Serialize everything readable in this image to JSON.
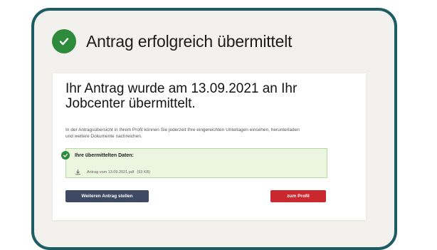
{
  "header": {
    "title": "Antrag erfolgreich übermittelt"
  },
  "card": {
    "heading": "Ihr Antrag wurde am 13.09.2021 an Ihr Jobcenter übermittelt.",
    "text": "In der Antragsübersicht in Ihrem Profil können Sie jederzeit Ihre eingereichten Unterlagen einsehen, herunterladen und weitere Dokumente nachreichen.",
    "data_box": {
      "title": "Ihre übermittelten Daten:",
      "file_name": "Antrag vom 13.09.2021.pdf",
      "file_size": "(93 KB)"
    },
    "buttons": {
      "secondary": "Weiteren Antrag stellen",
      "primary": "zum Profil"
    }
  },
  "colors": {
    "frame": "#1d5c62",
    "success": "#2e8b3c",
    "secondary_button": "#3e4a63",
    "primary_button": "#c9282f",
    "data_box_bg": "#ecf5df"
  },
  "icons": {
    "header": "check-circle-icon",
    "data_box": "check-circle-icon",
    "file": "download-icon"
  }
}
